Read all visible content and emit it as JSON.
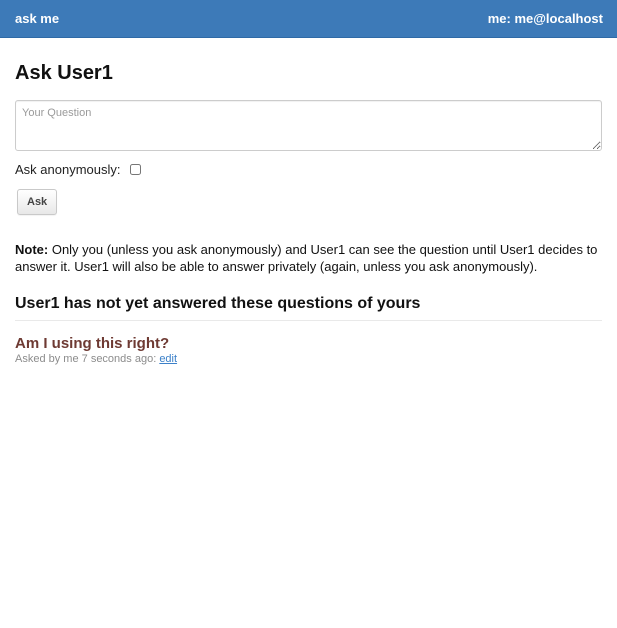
{
  "topbar": {
    "brand": "ask me",
    "user": "me: me@localhost",
    "color": "#3d7ab8"
  },
  "page": {
    "title": "Ask User1"
  },
  "form": {
    "question_placeholder": "Your Question",
    "question_value": "",
    "anonymous_label": "Ask anonymously:",
    "anonymous_checked": false,
    "ask_button": "Ask"
  },
  "note": {
    "label": "Note:",
    "text": " Only you (unless you ask anonymously) and User1 can see the question until User1 decides to answer it. User1 will also be able to answer privately (again, unless you ask anonymously)."
  },
  "unanswered": {
    "heading": "User1 has not yet answered these questions of yours",
    "questions": [
      {
        "title": "Am I using this right?",
        "meta": "Asked by me 7 seconds ago: ",
        "edit_label": "edit"
      }
    ]
  }
}
